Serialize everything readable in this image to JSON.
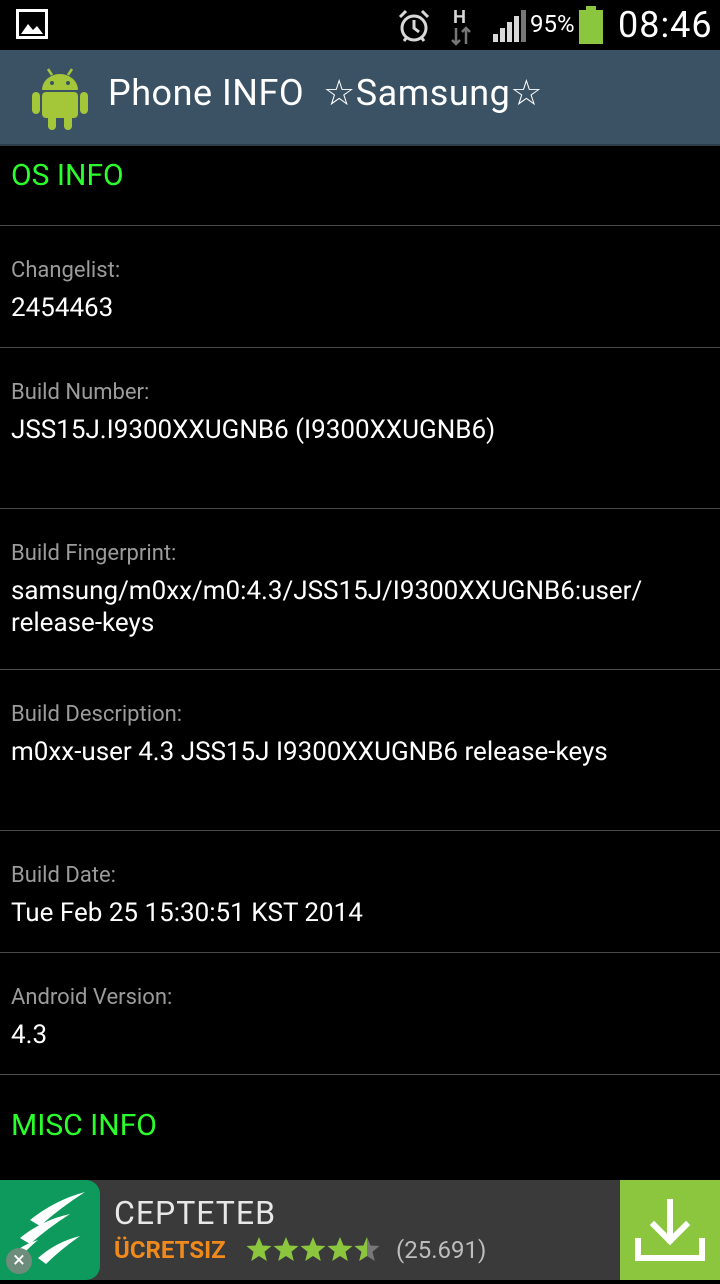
{
  "status_bar": {
    "battery_percent": "95%",
    "time": "08:46",
    "network_type": "H",
    "icons": [
      "gallery-icon",
      "alarm-icon",
      "hspa-data-icon",
      "signal-icon",
      "battery-icon"
    ]
  },
  "app_bar": {
    "title": "Phone INFO  ☆Samsung☆",
    "icon": "android-robot-icon"
  },
  "sections": {
    "os": {
      "header": "OS INFO",
      "rows": [
        {
          "label": "Changelist:",
          "value": "2454463"
        },
        {
          "label": "Build Number:",
          "value": "JSS15J.I9300XXUGNB6 (I9300XXUGNB6)"
        },
        {
          "label": "Build Fingerprint:",
          "value": "samsung/m0xx/m0:4.3/JSS15J/I9300XXUGNB6:user/ release-keys"
        },
        {
          "label": "Build Description:",
          "value": "m0xx-user 4.3 JSS15J I9300XXUGNB6 release-keys"
        },
        {
          "label": "Build Date:",
          "value": "Tue Feb 25 15:30:51 KST 2014"
        },
        {
          "label": "Android Version:",
          "value": "4.3"
        }
      ]
    },
    "misc": {
      "header": "MISC INFO"
    }
  },
  "ad": {
    "app_name": "CEPTETEB",
    "price": "ÜCRETSIZ",
    "rating": 4.5,
    "rating_count": "(25.691)",
    "close_symbol": "×",
    "colors": {
      "logo_bg": "#0e9a5c",
      "download_bg": "#8cc63f",
      "price": "#f08a1c",
      "stars": "#8cc63f"
    }
  },
  "colors": {
    "section_header": "#2bff2b",
    "app_bar": "#3b5265",
    "label": "#9b9b9b",
    "value": "#ffffff"
  }
}
